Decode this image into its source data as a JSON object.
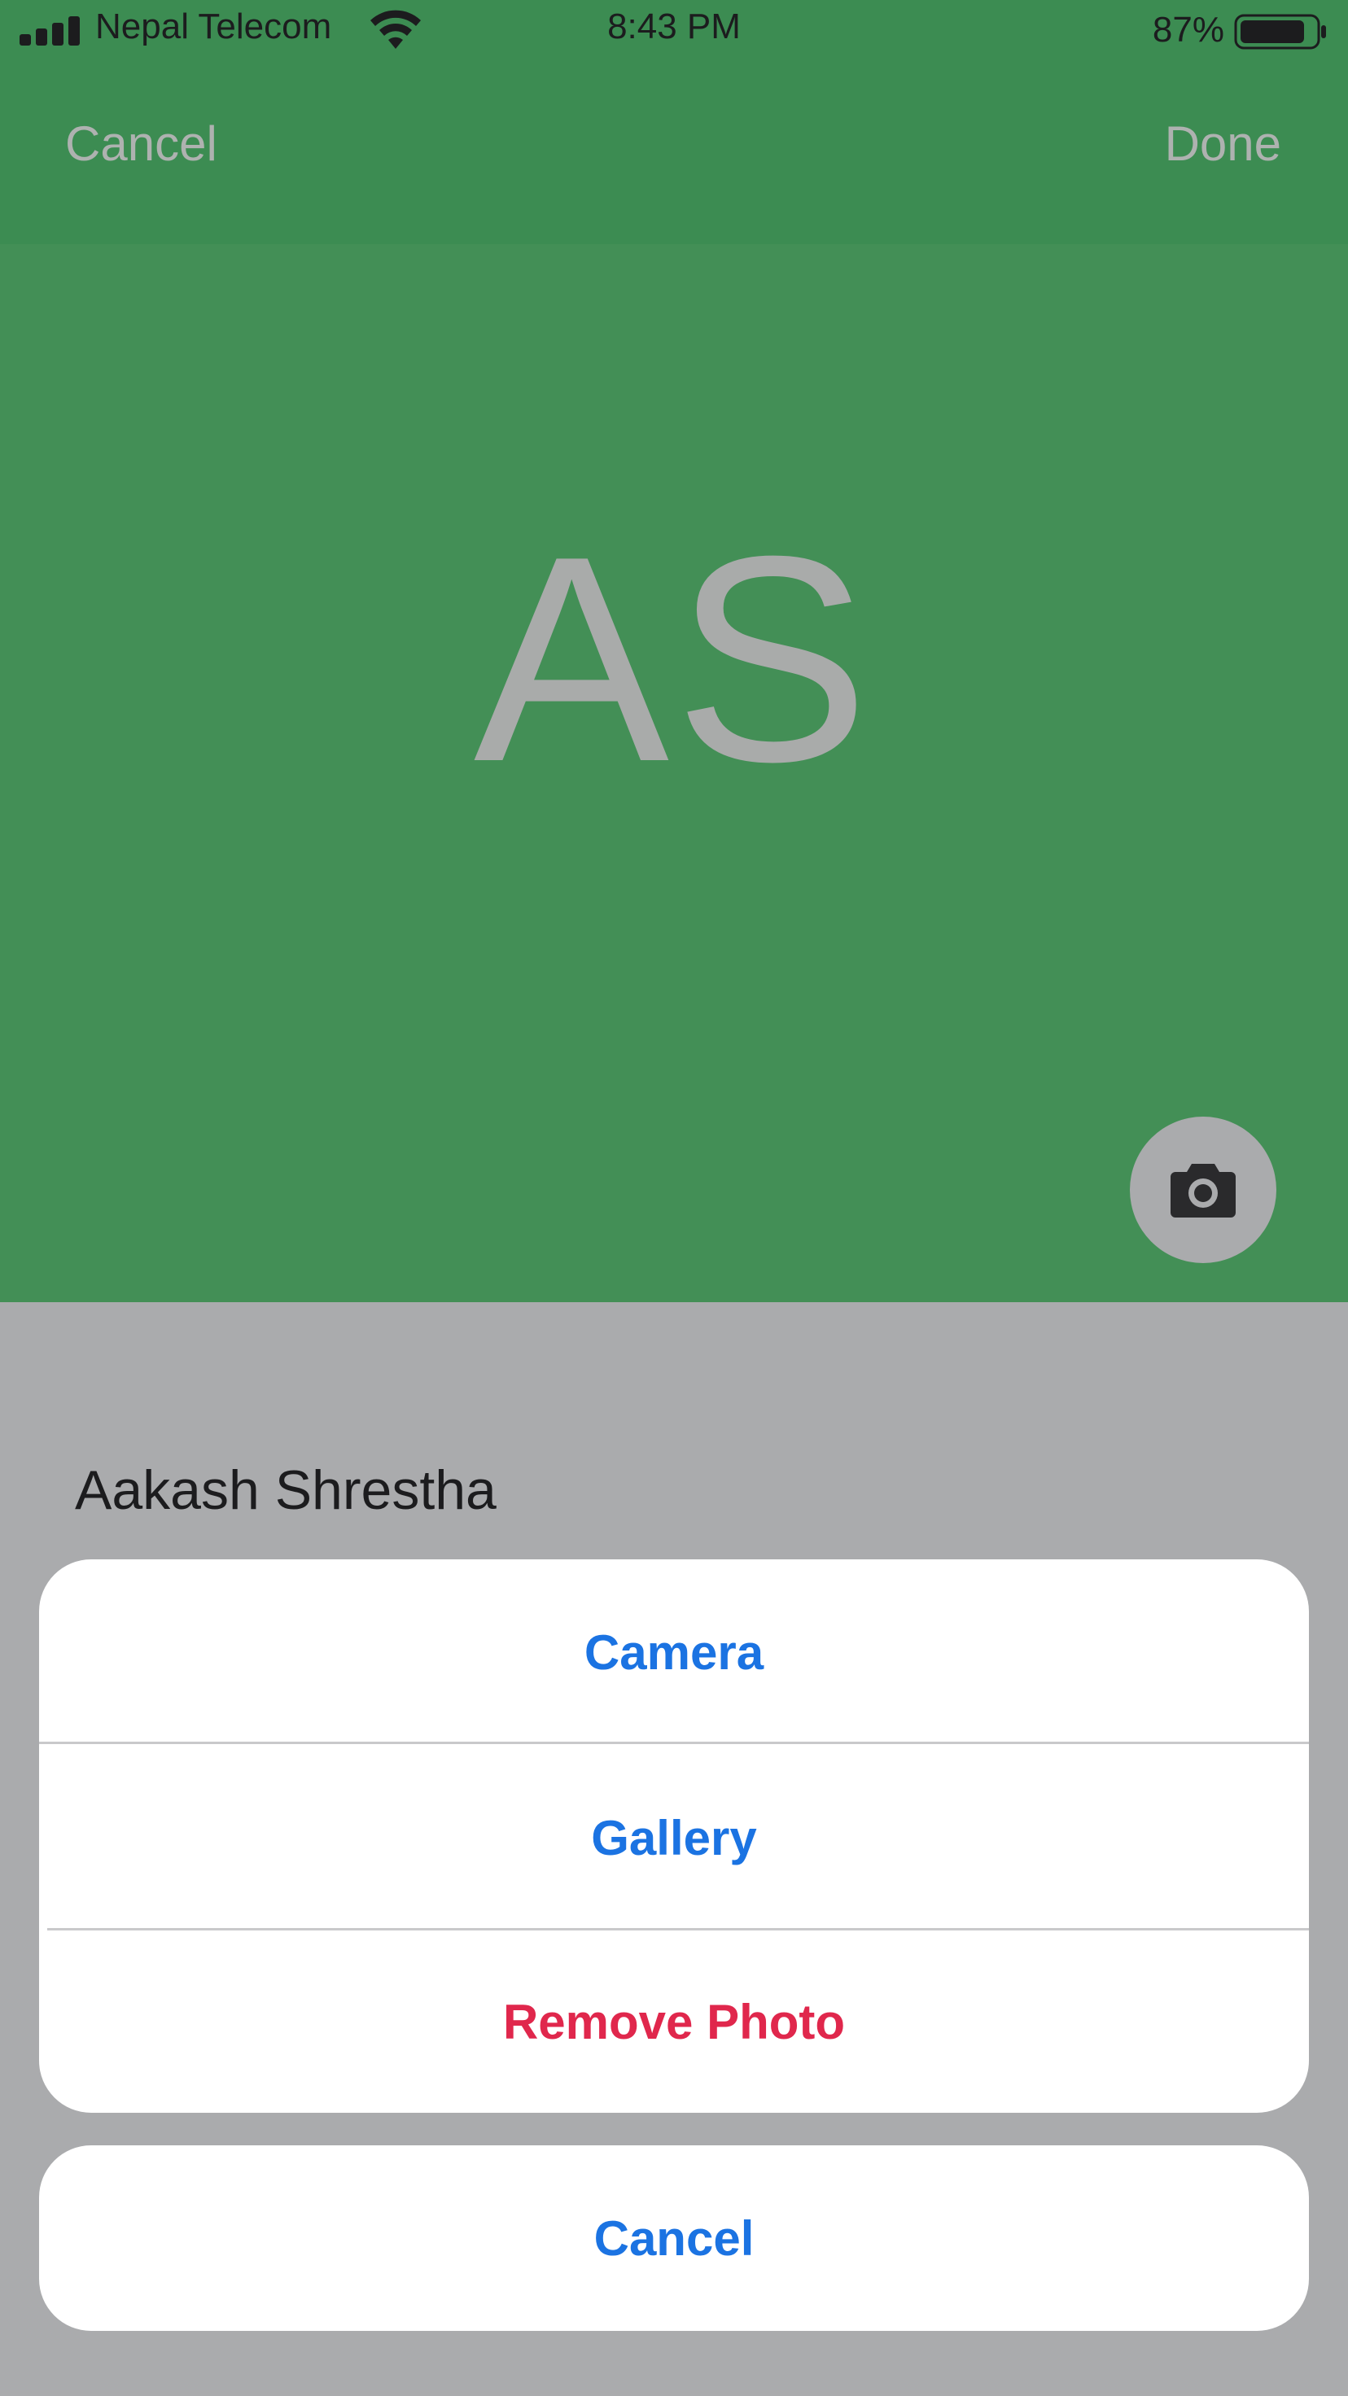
{
  "status_bar": {
    "carrier": "Nepal Telecom",
    "time": "8:43 PM",
    "battery": "87%",
    "battery_level": 0.87,
    "icons": [
      "signal-icon",
      "wifi-icon",
      "battery-icon"
    ]
  },
  "nav": {
    "cancel_label": "Cancel",
    "done_label": "Done"
  },
  "avatar": {
    "initials": "AS",
    "background_color": "#438f56",
    "camera_icon": "camera-icon"
  },
  "profile": {
    "name": "Aakash Shrestha"
  },
  "action_sheet": {
    "items": [
      {
        "label": "Camera",
        "color": "#1b73e2"
      },
      {
        "label": "Gallery",
        "color": "#1b73e2"
      },
      {
        "label": "Remove Photo",
        "color": "#e0274c"
      }
    ],
    "cancel_label": "Cancel"
  }
}
